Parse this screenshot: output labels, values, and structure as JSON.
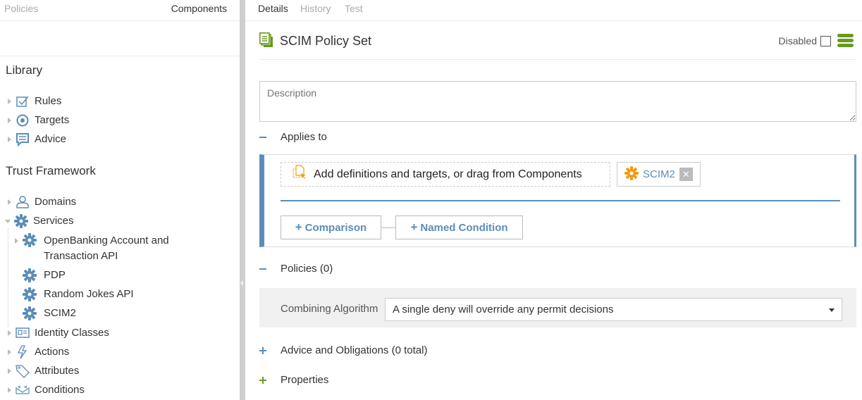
{
  "left_panel": {
    "tabs": [
      {
        "label": "Policies",
        "active": false
      },
      {
        "label": "Components",
        "active": true
      }
    ],
    "library": {
      "title": "Library",
      "items": [
        {
          "label": "Rules",
          "icon": "checkbox-icon"
        },
        {
          "label": "Targets",
          "icon": "target-icon"
        },
        {
          "label": "Advice",
          "icon": "speech-bubble-icon"
        }
      ]
    },
    "trust_framework": {
      "title": "Trust Framework",
      "items": [
        {
          "label": "Domains",
          "icon": "user-icon",
          "expanded": false
        },
        {
          "label": "Services",
          "icon": "gear-icon",
          "expanded": true,
          "children": [
            {
              "label": "OpenBanking Account and",
              "label2": "Transaction API",
              "expandable": true
            },
            {
              "label": "PDP"
            },
            {
              "label": "Random Jokes API"
            },
            {
              "label": "SCIM2"
            }
          ]
        },
        {
          "label": "Identity Classes",
          "icon": "id-card-icon",
          "expanded": false
        },
        {
          "label": "Actions",
          "icon": "lightning-icon",
          "expanded": false
        },
        {
          "label": "Attributes",
          "icon": "tag-icon",
          "expanded": false
        },
        {
          "label": "Conditions",
          "icon": "conditions-icon",
          "expanded": false
        }
      ]
    }
  },
  "right_panel": {
    "tabs": [
      {
        "label": "Details",
        "active": true
      },
      {
        "label": "History",
        "active": false
      },
      {
        "label": "Test",
        "active": false
      }
    ],
    "title": "SCIM Policy Set",
    "disabled_label": "Disabled",
    "disabled_checked": false,
    "description_placeholder": "Description",
    "applies_to": {
      "label": "Applies to",
      "toggle": "-",
      "add_definitions_text": "Add definitions and targets, or drag from Components",
      "target_chip": "SCIM2",
      "comparison_button": "Comparison",
      "named_condition_button": "Named Condition"
    },
    "policies": {
      "label": "Policies (0)",
      "toggle": "-",
      "combining_algorithm_label": "Combining Algorithm",
      "combining_algorithm_value": "A single deny will override any permit decisions"
    },
    "advice": {
      "label": "Advice and Obligations (0 total)",
      "toggle": "+"
    },
    "properties": {
      "label": "Properties",
      "toggle": "+"
    }
  },
  "colors": {
    "accent_blue": "#5b8db8",
    "accent_green": "#6a9a1f",
    "accent_orange": "#f39c12"
  }
}
